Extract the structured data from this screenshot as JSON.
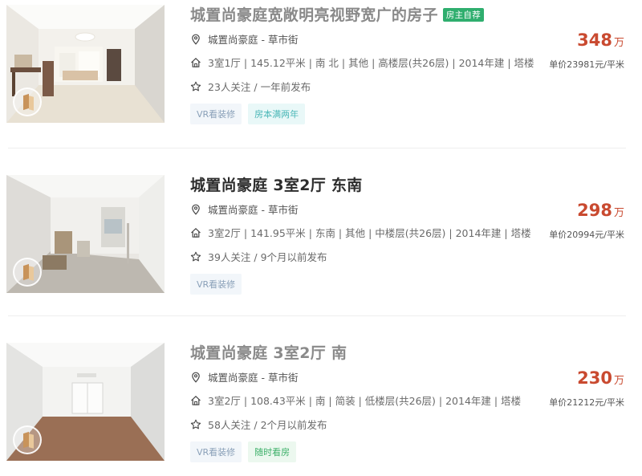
{
  "listings": [
    {
      "title": "城置尚豪庭宽敞明亮视野宽广的房子",
      "title_faded": true,
      "owner_tag": "房主自荐",
      "location": "城置尚豪庭 - 草市街",
      "info": "3室1厅 | 145.12平米 | 南 北 | 其他 | 高楼层(共26层) | 2014年建 | 塔楼",
      "follow": "23人关注 / 一年前发布",
      "tags": [
        {
          "label": "VR看装修",
          "style": "vr"
        },
        {
          "label": "房本满两年",
          "style": "cyan"
        }
      ],
      "price": "348",
      "price_unit": "万",
      "unit_price": "单价23981元/平米"
    },
    {
      "title": "城置尚豪庭 3室2厅 东南",
      "title_faded": false,
      "location": "城置尚豪庭 - 草市街",
      "info": "3室2厅 | 141.95平米 | 东南 | 其他 | 中楼层(共26层) | 2014年建 | 塔楼",
      "follow": "39人关注 / 9个月以前发布",
      "tags": [
        {
          "label": "VR看装修",
          "style": "vr"
        }
      ],
      "price": "298",
      "price_unit": "万",
      "unit_price": "单价20994元/平米"
    },
    {
      "title": "城置尚豪庭 3室2厅 南",
      "title_faded": true,
      "location": "城置尚豪庭 - 草市街",
      "info": "3室2厅 | 108.43平米 | 南 | 简装 | 低楼层(共26层) | 2014年建 | 塔楼",
      "follow": "58人关注 / 2个月以前发布",
      "tags": [
        {
          "label": "VR看装修",
          "style": "vr"
        },
        {
          "label": "随时看房",
          "style": "green"
        }
      ],
      "price": "230",
      "price_unit": "万",
      "unit_price": "单价21212元/平米"
    }
  ],
  "icons": {
    "location": "location-pin-icon",
    "house": "house-icon",
    "follow": "star-icon",
    "vr": "vr-cube-icon"
  },
  "colors": {
    "price": "#c94a30",
    "owner_tag": "#2fae6e",
    "title": "#2d2d2d",
    "title_faded": "#8a8a8a"
  }
}
